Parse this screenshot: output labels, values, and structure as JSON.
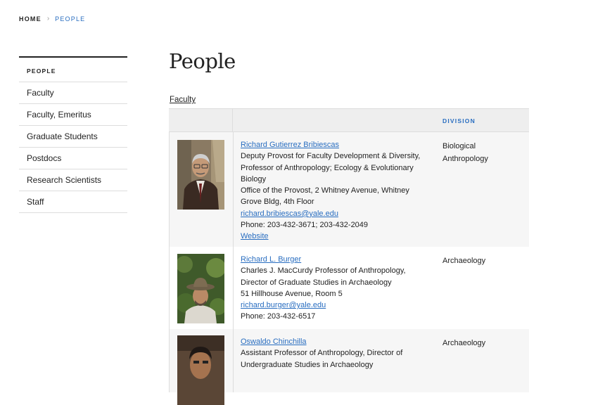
{
  "breadcrumb": {
    "home": "Home",
    "separator": "›",
    "current": "People"
  },
  "sidebar": {
    "title": "People",
    "items": [
      "Faculty",
      "Faculty, Emeritus",
      "Graduate Students",
      "Postdocs",
      "Research Scientists",
      "Staff"
    ]
  },
  "page": {
    "title": "People",
    "section_label": "Faculty"
  },
  "table": {
    "headers": {
      "photo": "",
      "info": "",
      "division": "Division"
    },
    "rows": [
      {
        "name": "Richard Gutierrez Bribiescas",
        "lines": [
          "Deputy Provost for Faculty Development & Diversity, Professor of Anthropology; Ecology & Evolutionary Biology",
          "Office of the Provost, 2 Whitney Avenue, Whitney Grove Bldg, 4th Floor"
        ],
        "email": "richard.bribiescas@yale.edu",
        "phone": "Phone: 203-432-3671; 203-432-2049",
        "website": "Website",
        "division": "Biological Anthropology"
      },
      {
        "name": "Richard L. Burger",
        "lines": [
          "Charles J. MacCurdy Professor of Anthropology, Director of Graduate Studies in Archaeology",
          "51 Hillhouse Avenue, Room 5"
        ],
        "email": "richard.burger@yale.edu",
        "phone": "Phone: 203-432-6517",
        "division": "Archaeology"
      },
      {
        "name": "Oswaldo Chinchilla",
        "lines": [
          "Assistant Professor of Anthropology, Director of Undergraduate Studies in Archaeology"
        ],
        "division": "Archaeology"
      }
    ]
  },
  "colors": {
    "link": "#286dc0",
    "header_bg": "#eeeeee",
    "row_alt_bg": "#f6f6f6",
    "border": "#dddddd"
  }
}
